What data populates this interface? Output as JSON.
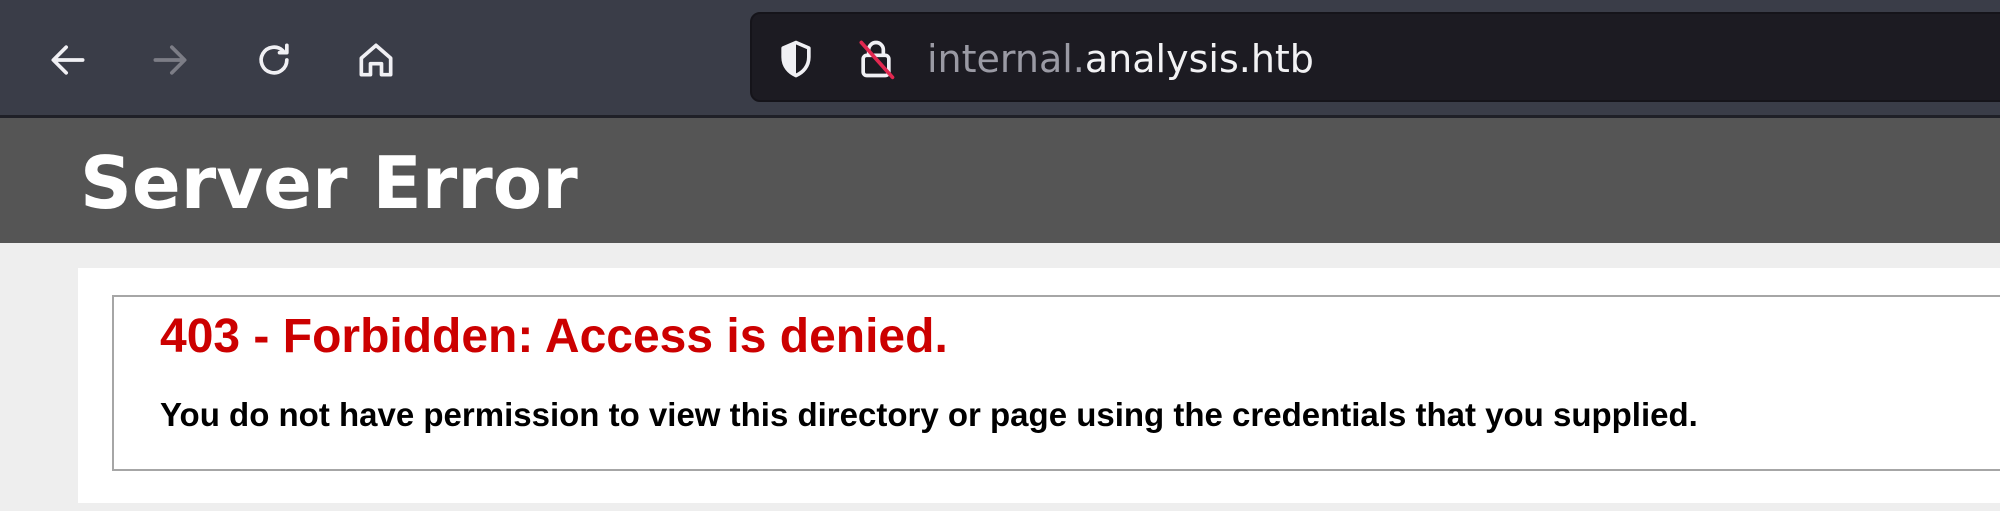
{
  "browser": {
    "url": {
      "subdomain": "internal.",
      "domain": "analysis.htb"
    },
    "icons": {
      "back": "back-arrow-icon",
      "forward": "forward-arrow-icon",
      "reload": "reload-icon",
      "home": "home-icon",
      "tracking_protection": "shield-icon",
      "insecure_connection": "insecure-lock-icon"
    }
  },
  "page": {
    "title": "Server Error",
    "error_heading": "403 - Forbidden: Access is denied.",
    "error_message": "You do not have permission to view this directory or page using the credentials that you supplied."
  },
  "colors": {
    "chrome_bg": "#3a3d48",
    "urlbar_bg": "#1c1b22",
    "header_bg": "#555555",
    "error_red": "#cc0000"
  }
}
